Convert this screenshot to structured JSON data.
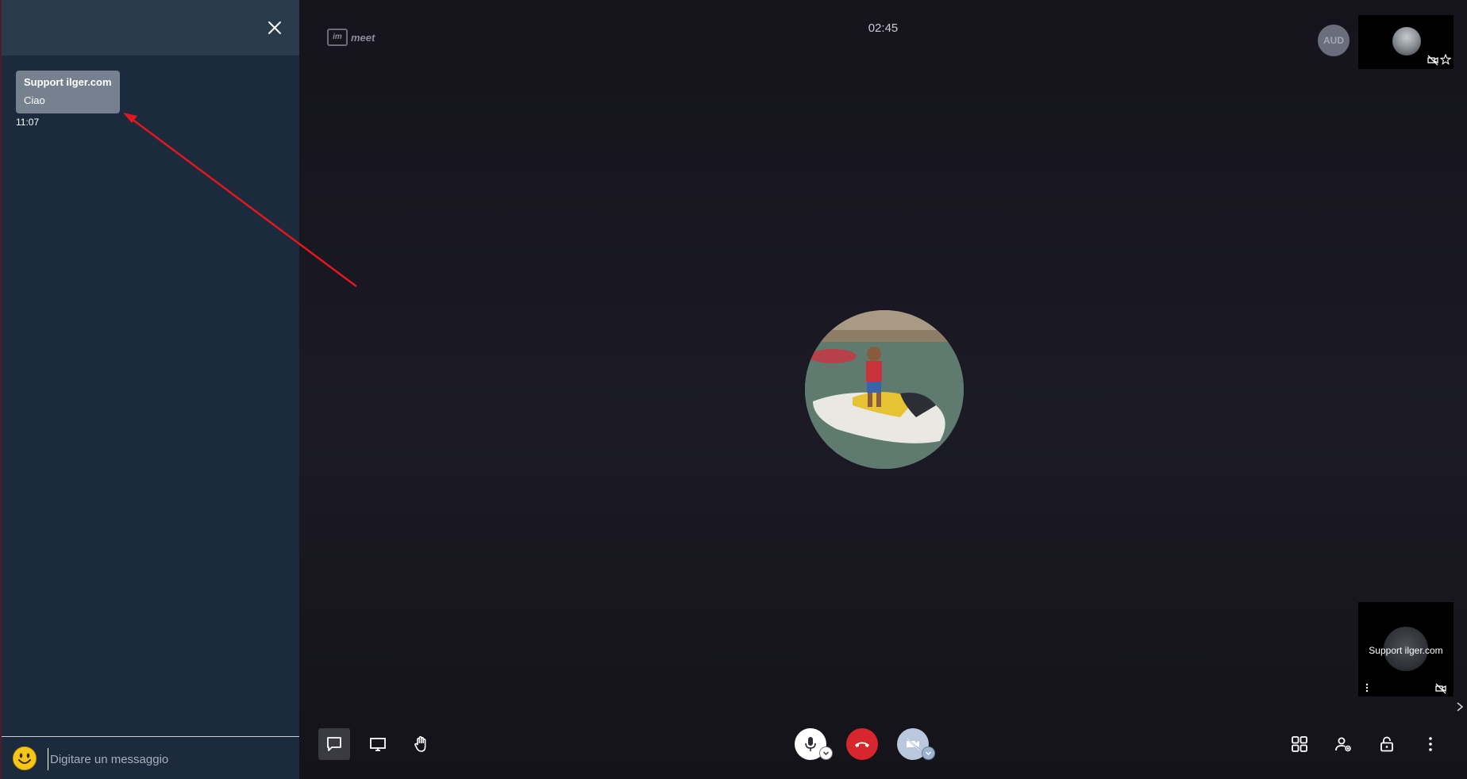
{
  "chat": {
    "messages": [
      {
        "sender": "Support ilger.com",
        "text": "Ciao",
        "time": "11:07"
      }
    ],
    "input_placeholder": "Digitare un messaggio"
  },
  "stage": {
    "logo_prefix": "im",
    "logo_suffix": "meet",
    "timer": "02:45",
    "aud_avatar_initials": "AUD",
    "remote_participant_name": "Support ilger.com"
  },
  "icons": {
    "chat_close": "close-icon",
    "emoji": "smiley-icon",
    "chat_toggle": "chat-icon",
    "screen_share": "desktop-icon",
    "raise_hand": "hand-icon",
    "mic": "microphone-icon",
    "hangup": "hangup-icon",
    "camera": "camera-off-icon",
    "tile_view": "tile-view-icon",
    "participants": "participants-icon",
    "security": "lock-icon",
    "more": "more-vertical-icon"
  },
  "colors": {
    "hangup_red": "#d8262e",
    "chat_panel_bg": "#1b2b3d",
    "annotation_arrow": "#e3171e"
  }
}
